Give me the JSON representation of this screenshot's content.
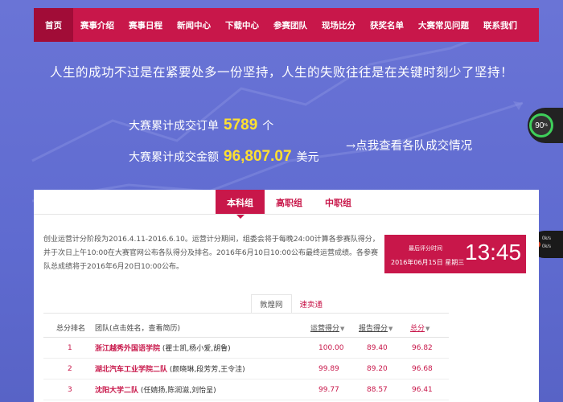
{
  "nav": {
    "items": [
      {
        "label": "首页",
        "active": true
      },
      {
        "label": "赛事介绍"
      },
      {
        "label": "赛事日程"
      },
      {
        "label": "新闻中心"
      },
      {
        "label": "下载中心"
      },
      {
        "label": "参赛团队"
      },
      {
        "label": "现场比分"
      },
      {
        "label": "获奖名单"
      },
      {
        "label": "大赛常见问题"
      },
      {
        "label": "联系我们"
      }
    ]
  },
  "slogan": "人生的成功不过是在紧要处多一份坚持，人生的失败往往是在关键时刻少了坚持！",
  "stats": {
    "orders_prefix": "大赛累计成交订单",
    "orders_value": "5789",
    "orders_unit": "个",
    "amount_prefix": "大赛累计成交金额",
    "amount_value": "96,807.07",
    "amount_unit": "美元"
  },
  "see_link": "→点我查看各队成交情况",
  "widgets": {
    "speed": "90",
    "speed_unit": "%",
    "net_up": "0k/s",
    "net_down": "0k/s"
  },
  "tabs": [
    {
      "label": "本科组",
      "active": true
    },
    {
      "label": "高职组"
    },
    {
      "label": "中职组"
    }
  ],
  "description": "创业运营计分阶段为2016.4.11-2016.6.10。运营计分期间，组委会将于每晚24:00计算各参赛队得分，并于次日上午10:00在大赛官网公布各队得分及排名。2016年6月10日10:00公布最终运营成绩。各参赛队总成绩将于2016年6月20日10:00公布。",
  "timebox": {
    "label": "最后评分时间",
    "date": "2016年06月15日 星期三",
    "clock": "13:45"
  },
  "subtabs": [
    {
      "label": "敦煌网",
      "active": true
    },
    {
      "label": "速卖通"
    }
  ],
  "table": {
    "headers": {
      "rank": "总分排名",
      "team": "团队(点击姓名，查看简历)",
      "ops": "运营得分",
      "report": "报告得分",
      "total": "总分"
    },
    "sort_icon": "▼",
    "rows": [
      {
        "rank": "1",
        "team": "浙江越秀外国语学院",
        "members": "(瞿士凯,杨小爱,胡鲁)",
        "ops": "100.00",
        "report": "89.40",
        "total": "96.82"
      },
      {
        "rank": "2",
        "team": "湖北汽车工业学院二队",
        "members": "(颜晓琳,段芳芳,王令洼)",
        "ops": "99.89",
        "report": "89.20",
        "total": "96.68"
      },
      {
        "rank": "3",
        "team": "沈阳大学二队",
        "members": "(任婧扬,陈润滋,刘怡呈)",
        "ops": "99.77",
        "report": "88.57",
        "total": "96.41"
      }
    ]
  },
  "colors": {
    "accent": "#c8174a",
    "highlight": "#ffe030",
    "background": "#6a74d6"
  }
}
